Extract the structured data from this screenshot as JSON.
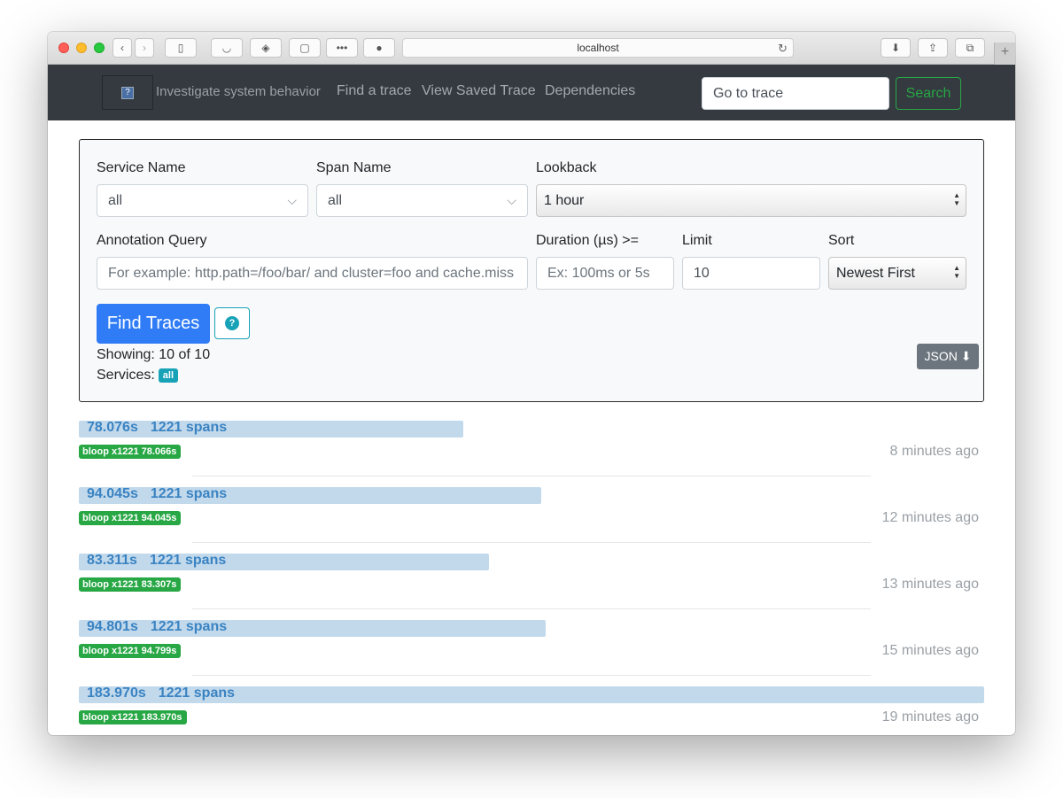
{
  "browser": {
    "url": "localhost"
  },
  "navbar": {
    "tagline": "Investigate system behavior",
    "links": [
      "Find a trace",
      "View Saved Trace",
      "Dependencies"
    ],
    "go_placeholder": "Go to trace",
    "search_label": "Search"
  },
  "form": {
    "service_label": "Service Name",
    "service_value": "all",
    "span_label": "Span Name",
    "span_value": "all",
    "lookback_label": "Lookback",
    "lookback_value": "1 hour",
    "annotation_label": "Annotation Query",
    "annotation_placeholder": "For example: http.path=/foo/bar/ and cluster=foo and cache.miss",
    "duration_label": "Duration (µs) >=",
    "duration_placeholder": "Ex: 100ms or 5s",
    "limit_label": "Limit",
    "limit_value": "10",
    "sort_label": "Sort",
    "sort_value": "Newest First",
    "find_label": "Find Traces",
    "help_icon": "?",
    "showing": "Showing: 10 of 10",
    "services_label": "Services:",
    "services_badge": "all",
    "json_label": "JSON"
  },
  "traces": [
    {
      "duration": "78.076s",
      "spans": "1221 spans",
      "tag": "bloop x1221 78.066s",
      "ago": "8 minutes ago",
      "fraction": 0.4244
    },
    {
      "duration": "94.045s",
      "spans": "1221 spans",
      "tag": "bloop x1221 94.045s",
      "ago": "12 minutes ago",
      "fraction": 0.5112
    },
    {
      "duration": "83.311s",
      "spans": "1221 spans",
      "tag": "bloop x1221 83.307s",
      "ago": "13 minutes ago",
      "fraction": 0.4529
    },
    {
      "duration": "94.801s",
      "spans": "1221 spans",
      "tag": "bloop x1221 94.799s",
      "ago": "15 minutes ago",
      "fraction": 0.5153
    },
    {
      "duration": "183.970s",
      "spans": "1221 spans",
      "tag": "bloop x1221 183.970s",
      "ago": "19 minutes ago",
      "fraction": 1.0
    }
  ]
}
